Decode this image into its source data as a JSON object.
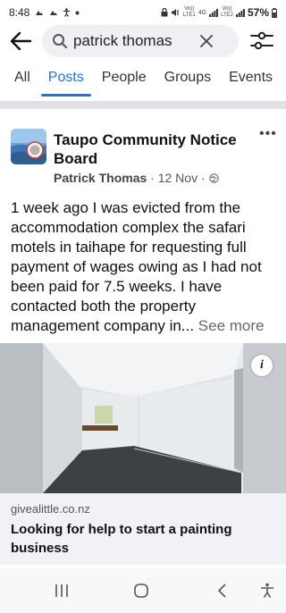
{
  "status_bar": {
    "time": "8:48",
    "left_icons": [
      "cloud-icon",
      "cloud-icon",
      "accessibility-icon",
      "dot-icon"
    ],
    "net1_top": "Vo))",
    "net1_bottom": "LTE1",
    "net2": "4G",
    "net3_top": "Vo))",
    "net3_bottom": "LTE2",
    "battery": "57%"
  },
  "search": {
    "query": "patrick thomas",
    "icons": [
      "back-arrow-icon",
      "search-icon",
      "clear-icon",
      "filter-icon"
    ]
  },
  "tabs": [
    {
      "label": "All"
    },
    {
      "label": "Posts"
    },
    {
      "label": "People"
    },
    {
      "label": "Groups"
    },
    {
      "label": "Events"
    }
  ],
  "active_tab": "Posts",
  "post": {
    "group_name": "Taupo Community Notice Board",
    "author": "Patrick Thomas",
    "date": "12 Nov",
    "separator": "·",
    "privacy_icon": "globe-icon",
    "text": "1 week ago I was evicted from the accommodation complex the safari motels in taihape for requesting full payment of wages owing as I had not been paid for 7.5 weeks. I have contacted both the property management company in...",
    "see_more": "See more",
    "link": {
      "domain": "givealittle.co.nz",
      "title": "Looking for help to start a painting business"
    }
  },
  "colors": {
    "accent": "#1b74e4",
    "divider": "#dfe1e5",
    "link_preview_bg": "#f0f2f5"
  }
}
